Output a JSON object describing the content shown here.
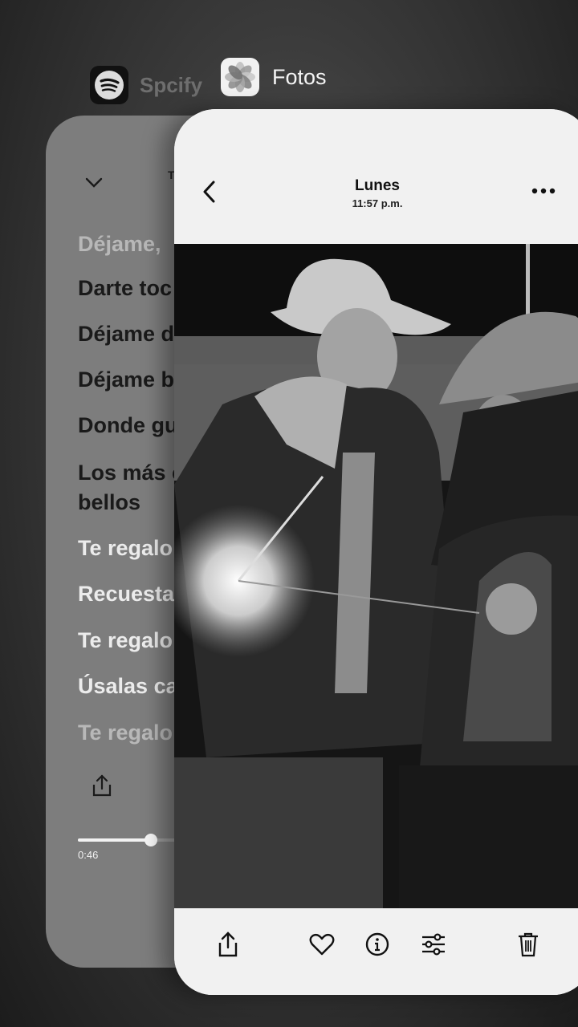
{
  "switcher": {
    "apps": [
      {
        "name": "Spotify",
        "display_name": "Spcify",
        "icon": "spotify-icon"
      },
      {
        "name": "Fotos",
        "display_name": "Fotos",
        "icon": "photos-icon"
      }
    ]
  },
  "spotify": {
    "tiny_title": "T",
    "lyrics": [
      "Déjame,",
      "Darte toc",
      "Déjame d",
      "Déjame b",
      "Donde gu",
      "Los más c",
      "bellos",
      "Te regalo",
      "Recuesta",
      "Te regalo",
      "Úsalas ca",
      "Te regalo"
    ],
    "progress_fraction": 0.35,
    "elapsed_time": "0:46"
  },
  "photos": {
    "title": "Lunes",
    "subtitle": "11:57 p.m.",
    "photo_description_icon": "photo",
    "toolbar": [
      "share-icon",
      "heart-icon",
      "info-icon",
      "adjust-icon",
      "trash-icon"
    ]
  }
}
